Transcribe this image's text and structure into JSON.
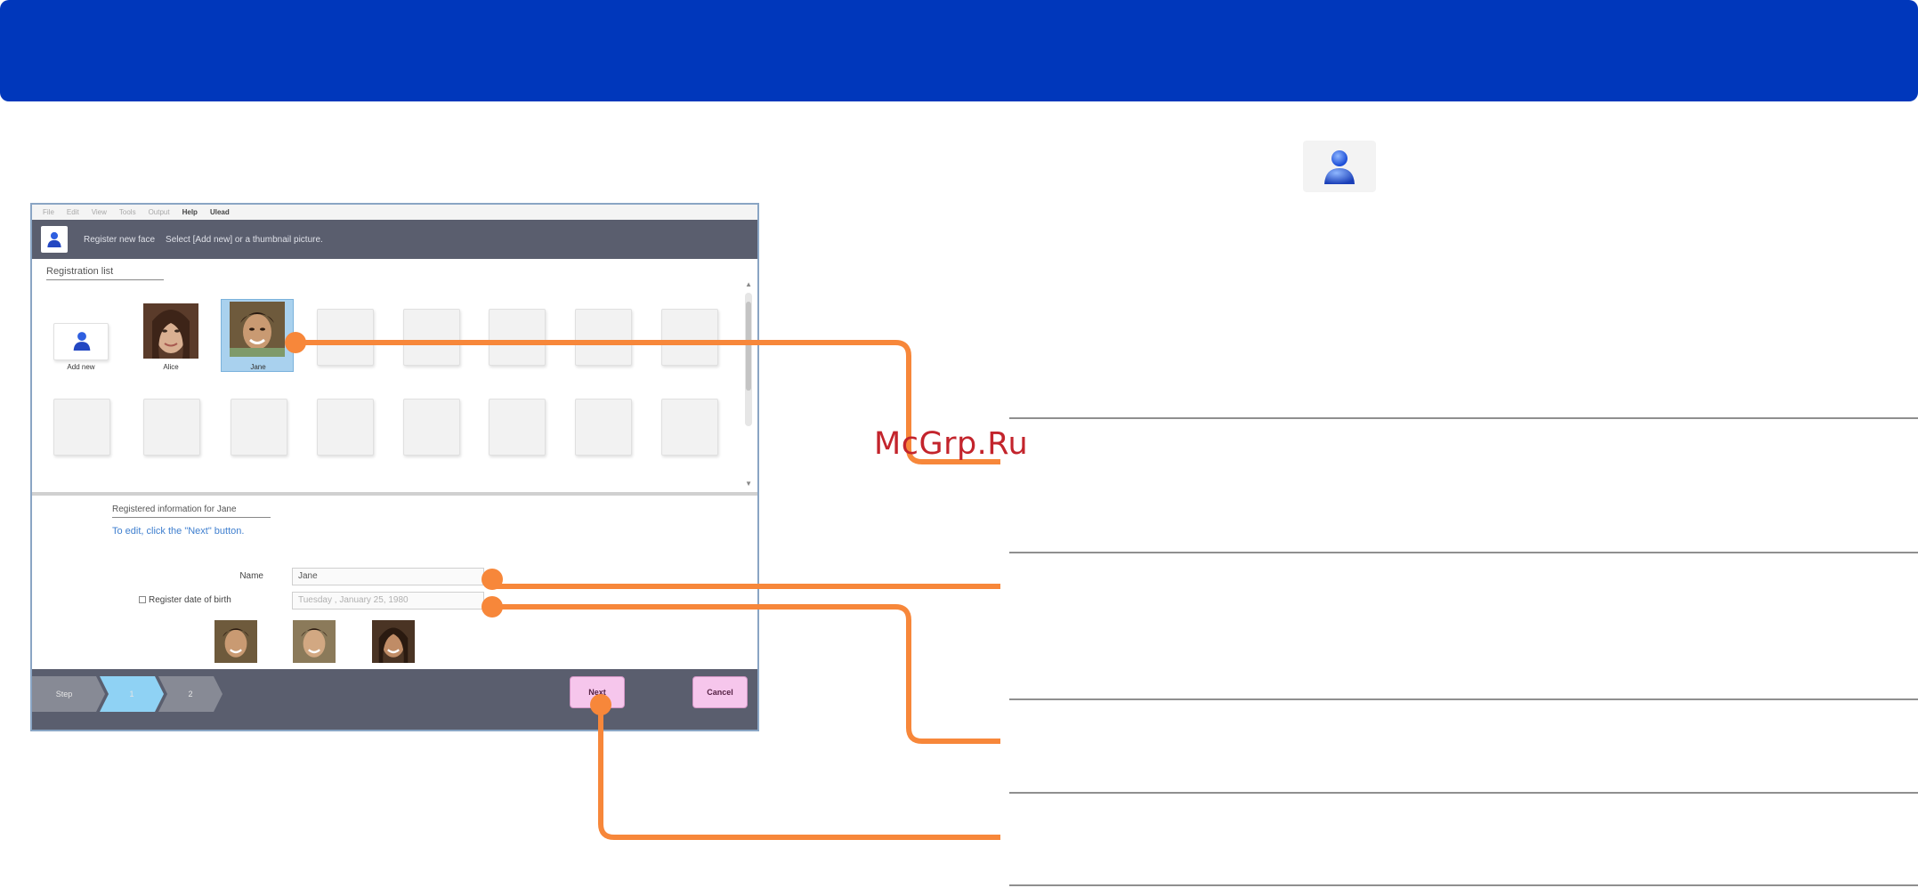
{
  "window": {
    "menu": [
      "File",
      "Edit",
      "View",
      "Tools",
      "Output",
      "Help",
      "Ulead"
    ],
    "header_title": "Register new face",
    "header_instruction": "Select [Add new] or a thumbnail picture."
  },
  "registration_list": {
    "title": "Registration list",
    "add_new_label": "Add new",
    "people": [
      {
        "name": "Alice"
      },
      {
        "name": "Jane"
      }
    ]
  },
  "registered_info": {
    "title": "Registered information for Jane",
    "hint": "To edit, click the \"Next\" button.",
    "name_label": "Name",
    "name_value": "Jane",
    "dob_label": "Register date of birth",
    "dob_value": "Tuesday , January 25, 1980"
  },
  "footer": {
    "step_label": "Step",
    "steps": [
      "1",
      "2"
    ],
    "next_label": "Next",
    "cancel_label": "Cancel"
  },
  "watermark": "McGrp.Ru",
  "colors": {
    "banner": "#0037bb",
    "callout": "#f7873a",
    "header": "#5a5e6e",
    "selected": "#a9d1ee",
    "button": "#f6c6ec"
  }
}
